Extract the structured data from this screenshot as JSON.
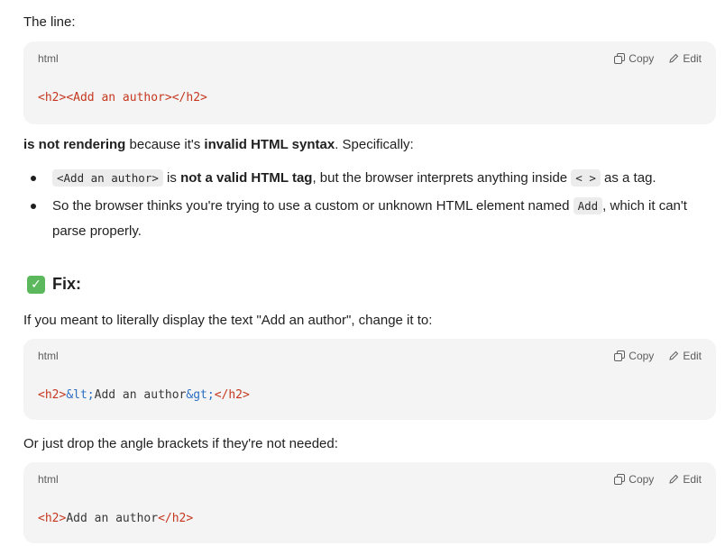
{
  "intro": "The line:",
  "code_blocks": [
    {
      "lang": "html",
      "copy": "Copy",
      "edit": "Edit",
      "code": {
        "open": "<h2>",
        "mid": "<Add an author>",
        "close": "</h2>"
      }
    },
    {
      "lang": "html",
      "copy": "Copy",
      "edit": "Edit",
      "code": {
        "open": "<h2>",
        "ent1": "&lt;",
        "text": "Add an author",
        "ent2": "&gt;",
        "close": "</h2>"
      }
    },
    {
      "lang": "html",
      "copy": "Copy",
      "edit": "Edit",
      "code": {
        "open": "<h2>",
        "text": "Add an author",
        "close": "</h2>"
      }
    }
  ],
  "explain": {
    "bold1": "is not rendering",
    "mid": " because it's ",
    "bold2": "invalid HTML syntax",
    "end": ". Specifically:"
  },
  "bullets": [
    {
      "code": "<Add an author>",
      "pre": " is ",
      "bold": "not a valid HTML tag",
      "post": ", but the browser interprets anything inside ",
      "code2": "< >",
      "end": " as a tag."
    },
    {
      "text": "So the browser thinks you're trying to use a custom or unknown HTML element named ",
      "code": "Add",
      "end": ", which it can't parse properly."
    }
  ],
  "fix_heading": "Fix:",
  "fix_text": "If you meant to literally display the text \"Add an author\", change it to:",
  "or_text": "Or just drop the angle brackets if they're not needed:"
}
